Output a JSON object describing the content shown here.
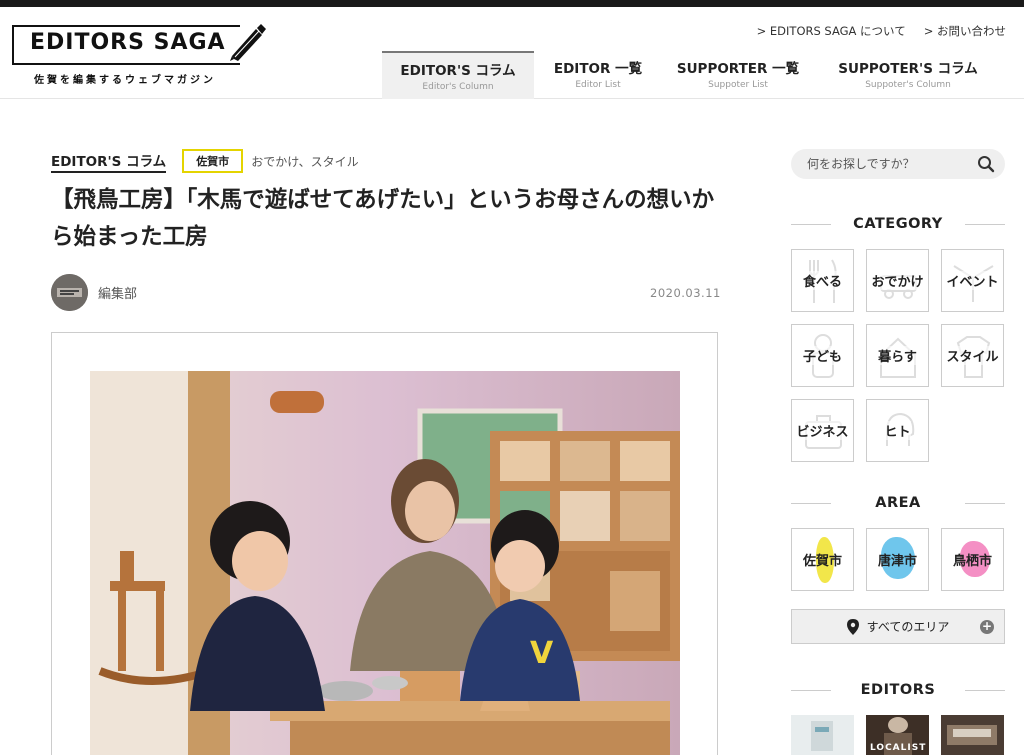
{
  "header": {
    "logo_title": "EDITORS SAGA",
    "logo_subtitle": "佐賀を編集するウェブマガジン",
    "util_links": [
      "> EDITORS SAGA について",
      "> お問い合わせ"
    ],
    "nav": [
      {
        "label": "EDITOR'S コラム",
        "sub": "Editor's Column",
        "active": true
      },
      {
        "label": "EDITOR 一覧",
        "sub": "Editor List",
        "active": false
      },
      {
        "label": "SUPPORTER 一覧",
        "sub": "Suppoter List",
        "active": false
      },
      {
        "label": "SUPPOTER'S コラム",
        "sub": "Suppoter's Column",
        "active": false
      }
    ]
  },
  "article": {
    "category": "EDITOR'S コラム",
    "area_tag": "佐賀市",
    "tags": "おでかけ、スタイル",
    "title": "【飛鳥工房】「木馬で遊ばせてあげたい」というお母さんの想いから始まった工房",
    "author": "編集部",
    "date": "2020.03.11"
  },
  "sidebar": {
    "search_placeholder": "何をお探しですか？",
    "category_heading": "CATEGORY",
    "categories": [
      "食べる",
      "おでかけ",
      "イベント",
      "子ども",
      "暮らす",
      "スタイル",
      "ビジネス",
      "ヒト"
    ],
    "area_heading": "AREA",
    "areas": [
      {
        "label": "佐賀市",
        "color": "#f2e64a"
      },
      {
        "label": "唐津市",
        "color": "#6fc6ec"
      },
      {
        "label": "鳥栖市",
        "color": "#f48fc4"
      }
    ],
    "all_area_label": "すべてのエリア",
    "editors_heading": "EDITORS",
    "editor_thumb_text": "LOCALIST"
  }
}
